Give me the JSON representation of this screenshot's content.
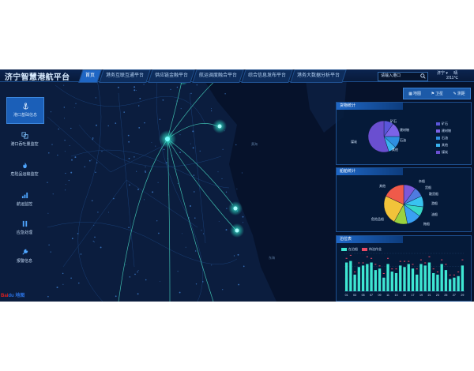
{
  "app": {
    "title": "济宁智慧港航平台",
    "nav": [
      "首页",
      "港务互联互通平台",
      "供应链金融平台",
      "航运调度融合平台",
      "综合信息发布平台",
      "港务大数据分析平台"
    ],
    "search_placeholder": "请输入港口",
    "weather": {
      "city": "济宁 ▾",
      "label": "晴",
      "temp": "2/11℃"
    },
    "tools": [
      "地图",
      "卫星",
      "测距"
    ]
  },
  "sidebar": [
    {
      "label": "港口基础信息",
      "icon": "anchor-icon"
    },
    {
      "label": "港口吞吐量监控",
      "icon": "copy-icon"
    },
    {
      "label": "危险品运输监控",
      "icon": "flame-icon"
    },
    {
      "label": "航运监控",
      "icon": "bars-icon"
    },
    {
      "label": "应急处理",
      "icon": "pause-icon"
    },
    {
      "label": "报警信息",
      "icon": "wrench-icon"
    }
  ],
  "map_labels": [
    "黄海",
    "东海"
  ],
  "logo": {
    "prefix": "Bai",
    "suffix": "du 地图"
  },
  "panels": {
    "goods": {
      "title": "货物统计",
      "legend": [
        "矿石",
        "建材物",
        "石油",
        "其他",
        "煤炭"
      ],
      "slice_labels": [
        "矿石",
        "建材物",
        "石油",
        "其他",
        "煤炭"
      ],
      "colors": [
        "#5a55d9",
        "#7d63e8",
        "#2e8ee0",
        "#39b2ee",
        "#6a4fd0"
      ]
    },
    "ships": {
      "title": "船舶统计",
      "slice_labels": [
        "杂船",
        "货船",
        "散货船",
        "游船",
        "油船",
        "拖船",
        "危险品船",
        "其他"
      ],
      "colors": [
        "#7c58d9",
        "#4f7be0",
        "#39c3f0",
        "#36d6c6",
        "#3aa0f2",
        "#9ad23e",
        "#f2c33a",
        "#ef5a4a"
      ]
    },
    "berth": {
      "title": "泊位表",
      "legend": [
        "在泊船",
        "待泊作业"
      ],
      "x_ticks": [
        "01",
        "02",
        "03",
        "04",
        "05",
        "06",
        "07",
        "08",
        "09",
        "10",
        "11",
        "12",
        "13",
        "14",
        "15",
        "16",
        "17",
        "18",
        "19",
        "20",
        "21",
        "22",
        "23",
        "24",
        "25",
        "26",
        "27",
        "28",
        "29"
      ]
    }
  },
  "chart_data": [
    {
      "type": "pie",
      "title": "货物统计",
      "categories": [
        "矿石",
        "建材物",
        "石油",
        "其他",
        "煤炭"
      ],
      "values": [
        10,
        15,
        12,
        8,
        55
      ]
    },
    {
      "type": "pie",
      "title": "船舶统计",
      "categories": [
        "杂船",
        "货船",
        "散货船",
        "游船",
        "油船",
        "拖船",
        "危险品船",
        "其他"
      ],
      "values": [
        10,
        8,
        9,
        8,
        12,
        11,
        24,
        18
      ]
    },
    {
      "type": "bar",
      "title": "泊位表",
      "categories": [
        "01",
        "02",
        "03",
        "04",
        "05",
        "06",
        "07",
        "08",
        "09",
        "10",
        "11",
        "12",
        "13",
        "14",
        "15",
        "16",
        "17",
        "18",
        "19",
        "20",
        "21",
        "22",
        "23",
        "24",
        "25",
        "26",
        "27",
        "28",
        "29"
      ],
      "series": [
        {
          "name": "在泊船",
          "values": [
            19,
            20,
            11,
            16,
            17,
            18,
            19,
            14,
            15,
            9,
            18,
            13,
            12,
            17,
            16,
            18,
            15,
            11,
            18,
            17,
            19,
            12,
            11,
            18,
            14,
            8,
            9,
            10,
            17
          ]
        },
        {
          "name": "待泊作业",
          "values": [
            3,
            4,
            2,
            3,
            2,
            5,
            3,
            4,
            2,
            3,
            4,
            2,
            3,
            3,
            4,
            2,
            3,
            4,
            3,
            2,
            4,
            3,
            2,
            3,
            4,
            3,
            2,
            3,
            4
          ]
        }
      ],
      "ylim": [
        0,
        25
      ]
    }
  ],
  "colors": {
    "accent": "#1f66c4",
    "background": "#06122b",
    "flow_line": "#4ff0d2",
    "bar": "#3ee6d2",
    "bar_marker": "#e84a64"
  }
}
